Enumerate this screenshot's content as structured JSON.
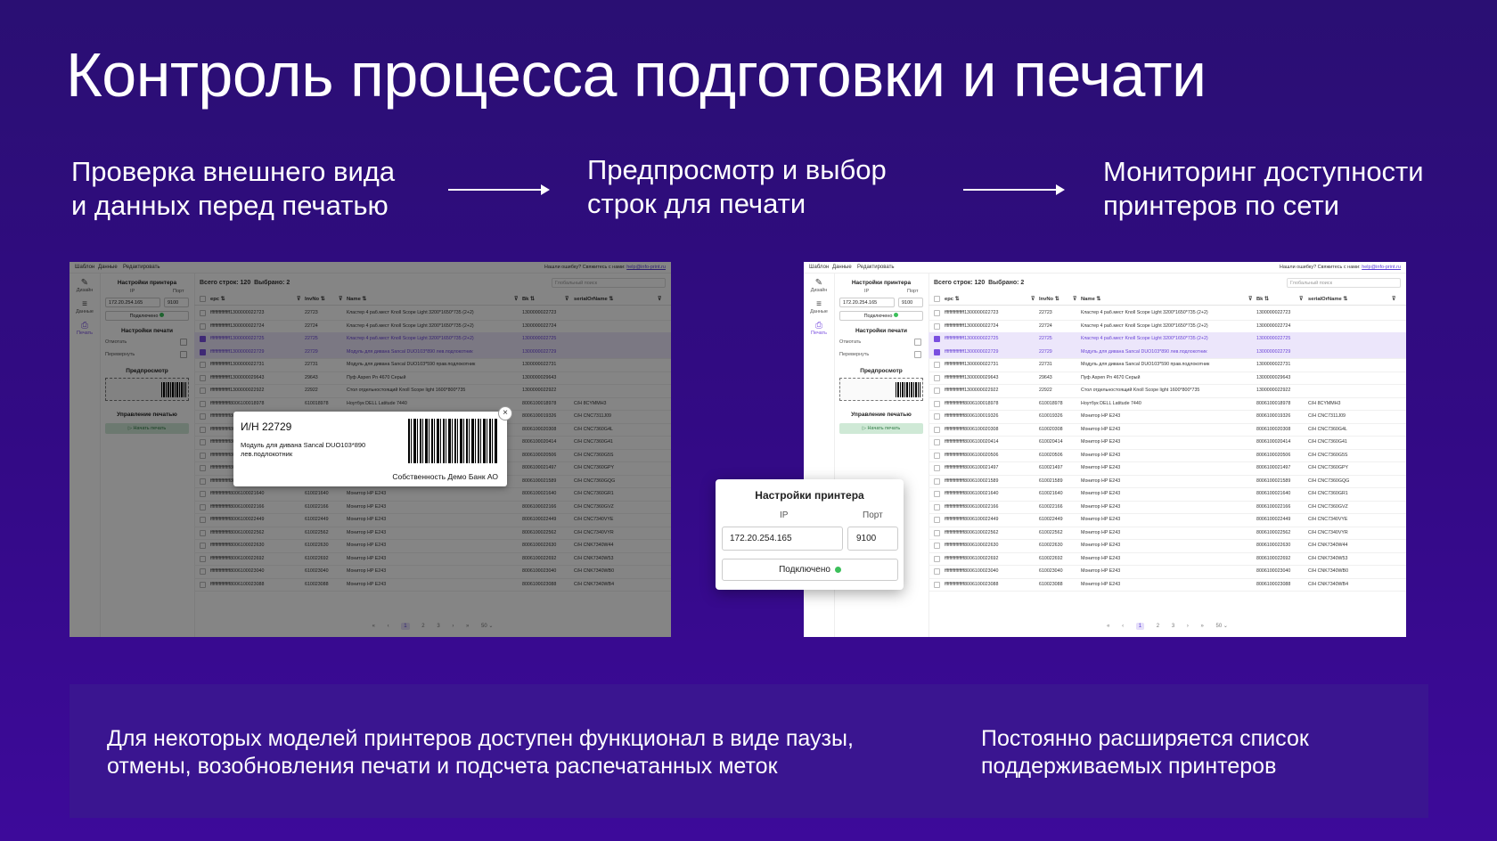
{
  "title": "Контроль процесса подготовки и печати",
  "steps": [
    {
      "line1": "Проверка внешнего вида",
      "line2": "и данных перед печатью"
    },
    {
      "line1": "Предпросмотр и выбор",
      "line2": "строк для печати"
    },
    {
      "line1": "Мониторинг доступности",
      "line2": "принтеров по сети"
    }
  ],
  "app": {
    "menu": [
      "Шаблон",
      "Данные",
      "Редактировать"
    ],
    "help_text": "Нашли ошибку? Свяжитесь с нами:",
    "help_link": "help@info-print.ru",
    "rail": [
      {
        "icon": "pencil-icon",
        "label": "Дизайн"
      },
      {
        "icon": "database-icon",
        "label": "Данные"
      },
      {
        "icon": "printer-icon",
        "label": "Печать"
      }
    ],
    "panel": {
      "printer_settings_title": "Настройки принтера",
      "ip_label": "IP",
      "port_label": "Порт",
      "ip_value": "172.20.254.165",
      "port_value": "9100",
      "connected_label": "Подключено",
      "print_settings_title": "Настройки печати",
      "peel_label": "Отмотать",
      "flip_label": "Перевернуть",
      "preview_title": "Предпросмотр",
      "print_mgmt_title": "Управление печатью",
      "start_print_label": "▷ Начать печать"
    },
    "grid": {
      "stats_left": "Всего строк: 120",
      "stats_right": "Выбрано: 2",
      "search_placeholder": "Глобальный поиск",
      "columns": [
        "epc ⇅",
        "InvNo ⇅",
        "Name ⇅",
        "Bk ⇅",
        "serialOrName ⇅"
      ],
      "rows": [
        [
          "ffffffffffffffff1300000022723",
          "22723",
          "Кластер 4 раб.мест Knoll Scope Light 3200*1650*735 (2+2)",
          "1300000022723",
          "",
          false
        ],
        [
          "ffffffffffffffff1300000022724",
          "22724",
          "Кластер 4 раб.мест Knoll Scope Light 3200*1650*735 (2+2)",
          "1300000022724",
          "",
          false
        ],
        [
          "ffffffffffffffff1300000022725",
          "22725",
          "Кластер 4 раб.мест Knoll Scope Light 3200*1650*735 (2+2)",
          "1300000022725",
          "",
          true
        ],
        [
          "ffffffffffffffff1300000022729",
          "22729",
          "Модуль для дивана Sancal DUO103*890 лев.подлокотник",
          "1300000022729",
          "",
          true
        ],
        [
          "ffffffffffffffff1300000022731",
          "22731",
          "Модуль для дивана Sancal DUO103*590 прав.подлокотник",
          "1300000022731",
          "",
          false
        ],
        [
          "ffffffffffffffff1300000029643",
          "29643",
          "Пуф Aspen Pn 4670 Серый",
          "1300000029643",
          "",
          false
        ],
        [
          "ffffffffffffffff1300000022922",
          "22922",
          "Стол отдельностоящий Knoll Scope light 1600*800*735",
          "1300000022922",
          "",
          false
        ],
        [
          "ffffffffffffffff8006100018978",
          "610018978",
          "Ноутбук DELL Latitude 7440",
          "8006100018978",
          "C/H 8CYMMH3",
          false
        ],
        [
          "ffffffffffffffff8006100019326",
          "610019326",
          "Монитор HP E243",
          "8006100019326",
          "C/H CNC7311J09",
          false
        ],
        [
          "ffffffffffffffff8006100020308",
          "610020308",
          "Монитор HP E243",
          "8006100020308",
          "C/H CNC7360G4L",
          false
        ],
        [
          "ffffffffffffffff8006100020414",
          "610020414",
          "Монитор HP E243",
          "8006100020414",
          "C/H CNC7360G41",
          false
        ],
        [
          "ffffffffffffffff8006100020506",
          "610020506",
          "Монитор HP E243",
          "8006100020506",
          "C/H CNC7360G5S",
          false
        ],
        [
          "ffffffffffffffff8006100021497",
          "610021497",
          "Монитор HP E243",
          "8006100021497",
          "C/H CNC7360GPY",
          false
        ],
        [
          "ffffffffffffffff8006100021589",
          "610021589",
          "Монитор HP E243",
          "8006100021589",
          "C/H CNC7360GQG",
          false
        ],
        [
          "ffffffffffffffff8006100021640",
          "610021640",
          "Монитор HP E243",
          "8006100021640",
          "C/H CNC7360GR1",
          false
        ],
        [
          "ffffffffffffffff8006100022166",
          "610022166",
          "Монитор HP E243",
          "8006100022166",
          "C/H CNC7360GVZ",
          false
        ],
        [
          "ffffffffffffffff8006100022449",
          "610022449",
          "Монитор HP E243",
          "8006100022449",
          "C/H CNC7340VYE",
          false
        ],
        [
          "ffffffffffffffff8006100022562",
          "610022562",
          "Монитор HP E243",
          "8006100022562",
          "C/H CNC7340VYR",
          false
        ],
        [
          "ffffffffffffffff8006100022630",
          "610022630",
          "Монитор HP E243",
          "8006100022630",
          "C/H CNK7340W44",
          false
        ],
        [
          "ffffffffffffffff8006100022692",
          "610022692",
          "Монитор HP E243",
          "8006100022692",
          "C/H CNK7340W53",
          false
        ],
        [
          "ffffffffffffffff8006100023040",
          "610023040",
          "Монитор HP E243",
          "8006100023040",
          "C/H CNK7340WB0",
          false
        ],
        [
          "ffffffffffffffff8006100023088",
          "610023088",
          "Монитор HP E243",
          "8006100023088",
          "C/H CNK7340WB4",
          false
        ]
      ],
      "pager": [
        "«",
        "‹",
        "1",
        "2",
        "3",
        "›",
        "»",
        "50 ⌄"
      ]
    }
  },
  "label_popup": {
    "inv_number": "И/Н 22729",
    "description": "Модуль для дивана Sancal DUO103*890 лев.подлокотник",
    "owner": "Собственность Демо Банк АО",
    "close_glyph": "×"
  },
  "printer_card": {
    "title": "Настройки принтера",
    "ip_label": "IP",
    "port_label": "Порт",
    "ip_value": "172.20.254.165",
    "port_value": "9100",
    "status_label": "Подключено"
  },
  "bottom": {
    "left_line1": "Для некоторых моделей принтеров доступен функционал в виде паузы,",
    "left_line2": "отмены, возобновления печати и подсчета распечатанных меток",
    "right_line1": "Постоянно расширяется список",
    "right_line2": "поддерживаемых принтеров"
  },
  "colors": {
    "accent": "#7a4fe0",
    "connected": "#3bbf5a",
    "background": "#2a0f73"
  }
}
